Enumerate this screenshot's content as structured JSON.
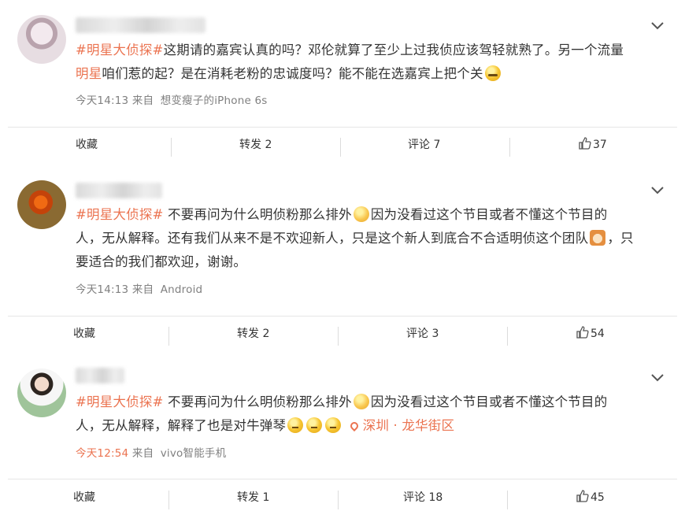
{
  "posts": [
    {
      "hashtag": "#明星大侦探#",
      "body_line1": "这期请的嘉宾认真的吗？邓伦就算了至少上过我侦应该驾轻就熟了。另一个流量",
      "body_line2_hl": "明星",
      "body_line2": "咱们惹的起？是在消耗老粉的忠诚度吗？能不能在选嘉宾上把个关",
      "emoji": "smirk-emoji",
      "time": "今天14:13",
      "from_label": "来自",
      "source": "想变瘦子的iPhone 6s",
      "actions": {
        "favorite": "收藏",
        "repost": "转发 2",
        "comment": "评论 7",
        "likes": "37"
      }
    },
    {
      "hashtag": "#明星大侦探#",
      "body_line1": " 不要再问为什么明侦粉那么排外",
      "body_line1b": "因为没看过这个节目或者不懂这个节目的",
      "body_line2": "人，无从解释。还有我们从来不是不欢迎新人，只是这个新人到底合不合适明侦这个团队",
      "body_line2b": "，只",
      "body_line3": "要适合的我们都欢迎，谢谢。",
      "time": "今天14:13",
      "from_label": "来自",
      "source": "Android",
      "actions": {
        "favorite": "收藏",
        "repost": "转发 2",
        "comment": "评论 3",
        "likes": "54"
      }
    },
    {
      "hashtag": "#明星大侦探#",
      "body_line1": " 不要再问为什么明侦粉那么排外",
      "body_line1b": "因为没看过这个节目或者不懂这个节目的",
      "body_line2": "人，无从解释，解释了也是对牛弹琴",
      "location": "深圳 · 龙华街区",
      "time": "今天12:54",
      "from_label": "来自",
      "source": "vivo智能手机",
      "actions": {
        "favorite": "收藏",
        "repost": "转发 1",
        "comment": "评论 18",
        "likes": "45"
      }
    }
  ],
  "colors": {
    "hashtag": "#eb7350",
    "meta": "#808080",
    "divider": "#e6e6e6"
  }
}
